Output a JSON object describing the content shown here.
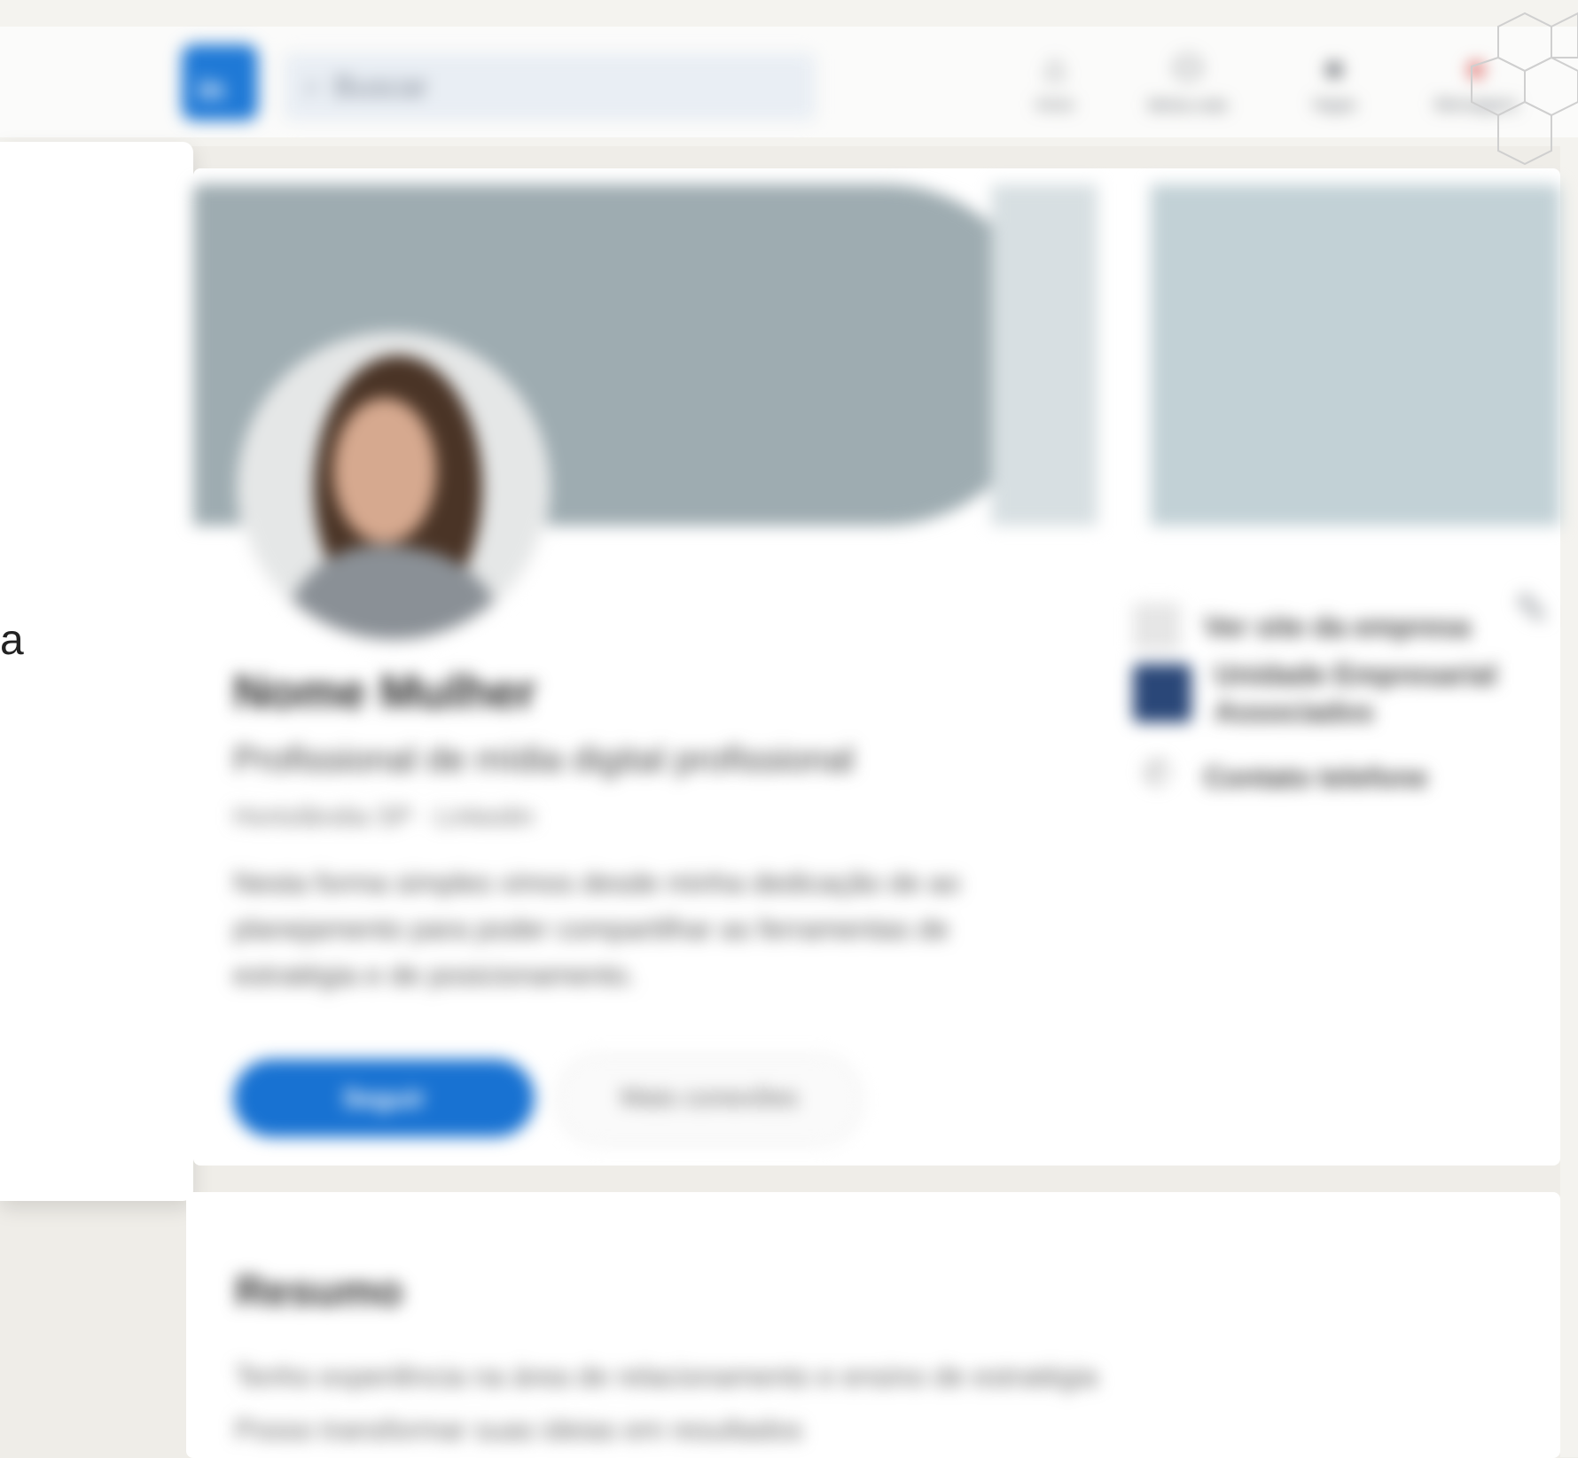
{
  "app": {
    "logo_text": "in"
  },
  "search": {
    "placeholder": "Buscar"
  },
  "nav": {
    "items": [
      {
        "label": "Início",
        "icon": "home-icon"
      },
      {
        "label": "Minha rede",
        "icon": "network-icon"
      },
      {
        "label": "Vagas",
        "icon": "jobs-icon"
      },
      {
        "label": "Mensagens",
        "icon": "messaging-icon"
      }
    ]
  },
  "left_panel": {
    "visible_char": "a"
  },
  "profile": {
    "name": "Nome Mulher",
    "headline": "Profissional de mídia digital profissional",
    "location": "Hortolândia SP · Linkedin",
    "about": "Nesta forma simples vimos desde minha dedicação de ao planejamento para poder compartilhar as ferramentas de estratégia e de posicionamento.",
    "follow_label": "Seguir",
    "more_label": "Mais conexões",
    "side_links": [
      {
        "text": "Ver site da empresa",
        "icon": "link-icon"
      },
      {
        "text": "Unidade Empresarial Associados",
        "icon": "company-logo-icon"
      },
      {
        "text": "Contato telefone",
        "icon": "phone-icon"
      }
    ]
  },
  "summary": {
    "title": "Resumo",
    "lines": [
      "Tenho experiência na área de relacionamento e ensino de estratégia",
      "Posso transformar suas ideias em resultados"
    ]
  },
  "colors": {
    "brand": "#1f79d6",
    "follow_button": "#1872d2",
    "banner": "#9eacb1"
  }
}
